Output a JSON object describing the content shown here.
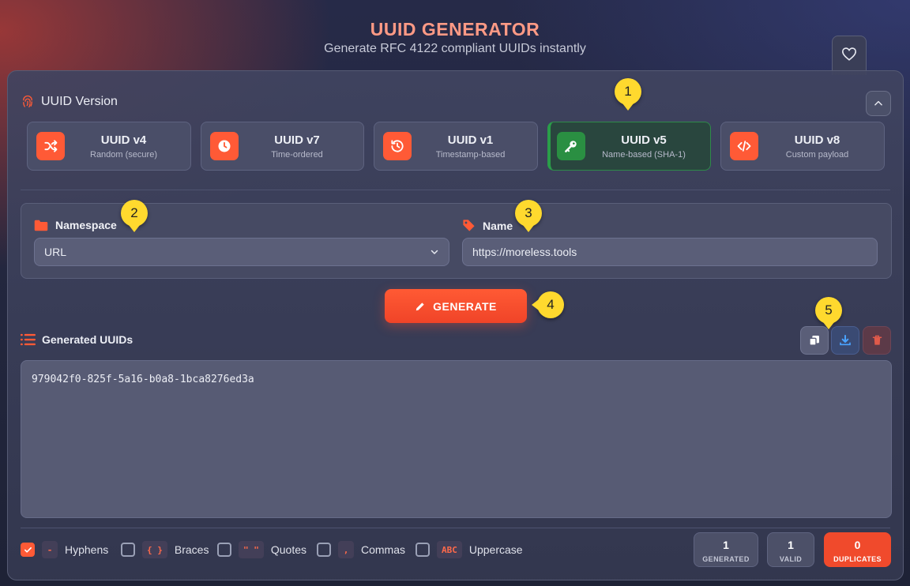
{
  "header": {
    "title": "UUID GENERATOR",
    "subtitle": "Generate RFC 4122 compliant UUIDs instantly"
  },
  "version_section": {
    "title": "UUID Version",
    "versions": [
      {
        "title": "UUID v4",
        "desc": "Random (secure)",
        "icon": "shuffle-icon"
      },
      {
        "title": "UUID v7",
        "desc": "Time-ordered",
        "icon": "clock-icon"
      },
      {
        "title": "UUID v1",
        "desc": "Timestamp-based",
        "icon": "history-icon"
      },
      {
        "title": "UUID v5",
        "desc": "Name-based (SHA-1)",
        "icon": "key-icon",
        "active": true
      },
      {
        "title": "UUID v8",
        "desc": "Custom payload",
        "icon": "code-icon"
      }
    ]
  },
  "form": {
    "namespace_label": "Namespace",
    "namespace_value": "URL",
    "name_label": "Name",
    "name_value": "https://moreless.tools"
  },
  "generate_label": "GENERATE",
  "output": {
    "title": "Generated UUIDs",
    "uuids": [
      "979042f0-825f-5a16-b0a8-1bca8276ed3a"
    ]
  },
  "options": [
    {
      "chip": "-",
      "label": "Hyphens",
      "checked": true
    },
    {
      "chip": "{ }",
      "label": "Braces",
      "checked": false
    },
    {
      "chip": "\" \"",
      "label": "Quotes",
      "checked": false
    },
    {
      "chip": ",",
      "label": "Commas",
      "checked": false
    },
    {
      "chip": "ABC",
      "label": "Uppercase",
      "checked": false
    }
  ],
  "stats": [
    {
      "value": "1",
      "label": "GENERATED"
    },
    {
      "value": "1",
      "label": "VALID"
    },
    {
      "value": "0",
      "label": "DUPLICATES"
    }
  ],
  "callouts": [
    "1",
    "2",
    "3",
    "4",
    "5"
  ],
  "colors": {
    "accent": "#ff5a36",
    "active_green": "#2a9d49",
    "callout": "#ffd92e"
  }
}
